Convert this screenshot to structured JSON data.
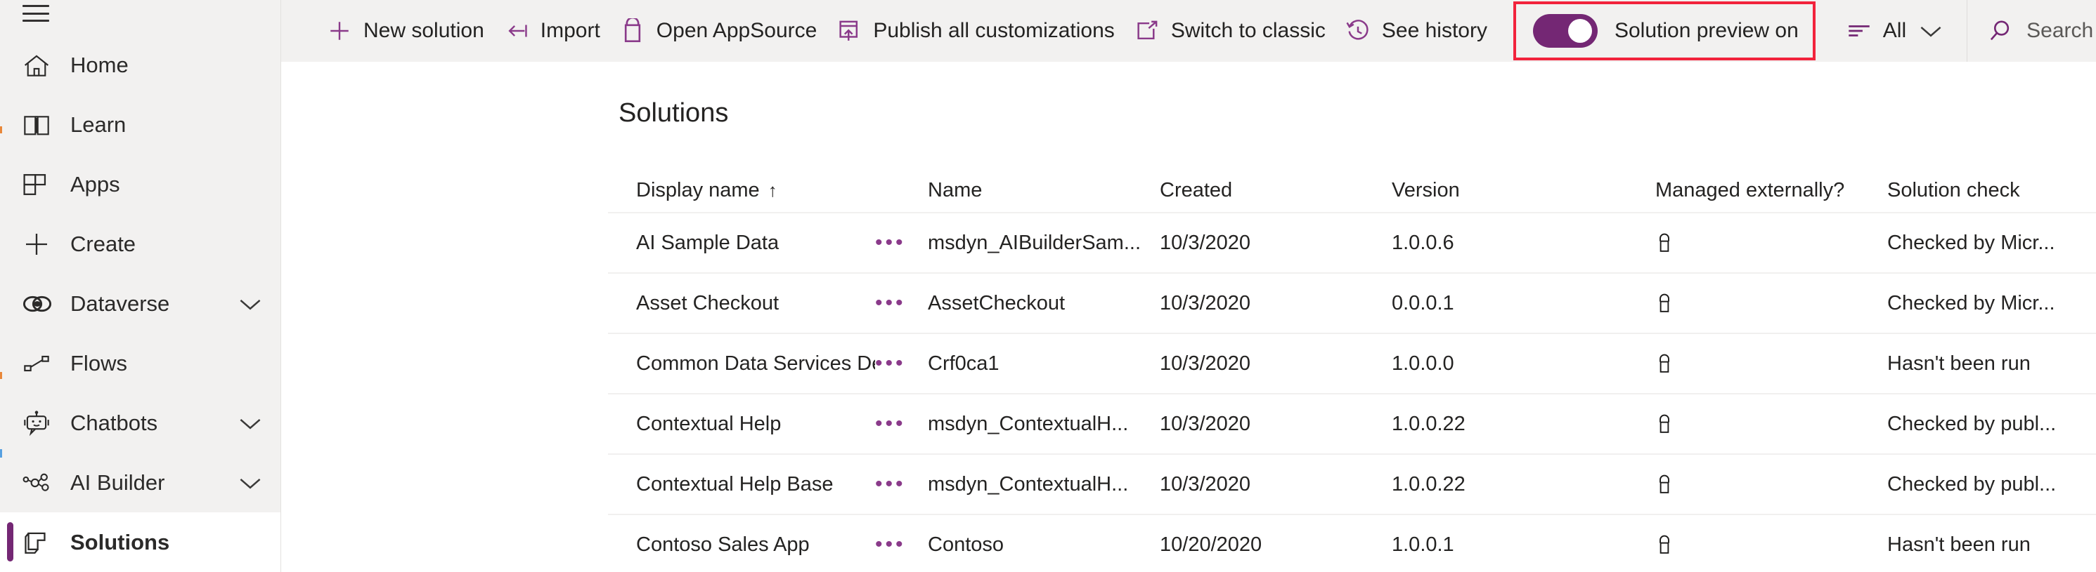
{
  "sidebar": {
    "hamburger_name": "hamburger-menu-icon",
    "items": [
      {
        "label": "Home",
        "icon": "home-icon",
        "chevron": false,
        "active": false
      },
      {
        "label": "Learn",
        "icon": "book-icon",
        "chevron": false,
        "active": false
      },
      {
        "label": "Apps",
        "icon": "apps-grid-icon",
        "chevron": false,
        "active": false
      },
      {
        "label": "Create",
        "icon": "plus-icon",
        "chevron": false,
        "active": false
      },
      {
        "label": "Dataverse",
        "icon": "dataverse-icon",
        "chevron": true,
        "active": false
      },
      {
        "label": "Flows",
        "icon": "flows-icon",
        "chevron": false,
        "active": false
      },
      {
        "label": "Chatbots",
        "icon": "chatbot-icon",
        "chevron": true,
        "active": false
      },
      {
        "label": "AI Builder",
        "icon": "ai-builder-icon",
        "chevron": true,
        "active": false
      },
      {
        "label": "Solutions",
        "icon": "solutions-icon",
        "chevron": false,
        "active": true
      }
    ]
  },
  "commandbar": {
    "commands": [
      {
        "label": "New solution",
        "icon": "plus-icon"
      },
      {
        "label": "Import",
        "icon": "import-arrow-icon"
      },
      {
        "label": "Open AppSource",
        "icon": "shopping-bag-icon"
      },
      {
        "label": "Publish all customizations",
        "icon": "publish-upload-icon"
      },
      {
        "label": "Switch to classic",
        "icon": "open-in-new-window-icon"
      },
      {
        "label": "See history",
        "icon": "history-clock-icon"
      }
    ],
    "toggle": {
      "label": "Solution preview on",
      "state": "on",
      "highlight_color": "#f2233c",
      "accent_color": "#742774"
    },
    "filter": {
      "label": "All",
      "icon": "filter-lines-icon",
      "chevron": "chevron-down-icon"
    },
    "search": {
      "label": "Search",
      "placeholder": "Search",
      "icon": "search-icon"
    }
  },
  "page": {
    "title": "Solutions"
  },
  "table": {
    "columns": [
      {
        "key": "display",
        "label": "Display name",
        "sort": "↑"
      },
      {
        "key": "name",
        "label": "Name",
        "sort": ""
      },
      {
        "key": "created",
        "label": "Created",
        "sort": ""
      },
      {
        "key": "version",
        "label": "Version",
        "sort": ""
      },
      {
        "key": "managed",
        "label": "Managed externally?",
        "sort": ""
      },
      {
        "key": "check",
        "label": "Solution check",
        "sort": ""
      }
    ],
    "row_menu_glyph": "•••",
    "managed_icon": "lock-icon",
    "rows": [
      {
        "display": "AI Sample Data",
        "name": "msdyn_AIBuilderSam...",
        "created": "10/3/2020",
        "version": "1.0.0.6",
        "managed": "lock-icon",
        "check": "Checked by Micr..."
      },
      {
        "display": "Asset Checkout",
        "name": "AssetCheckout",
        "created": "10/3/2020",
        "version": "0.0.0.1",
        "managed": "lock-icon",
        "check": "Checked by Micr..."
      },
      {
        "display": "Common Data Services Default Solution",
        "name": "Crf0ca1",
        "created": "10/3/2020",
        "version": "1.0.0.0",
        "managed": "lock-icon",
        "check": "Hasn't been run"
      },
      {
        "display": "Contextual Help",
        "name": "msdyn_ContextualH...",
        "created": "10/3/2020",
        "version": "1.0.0.22",
        "managed": "lock-icon",
        "check": "Checked by publ..."
      },
      {
        "display": "Contextual Help Base",
        "name": "msdyn_ContextualH...",
        "created": "10/3/2020",
        "version": "1.0.0.22",
        "managed": "lock-icon",
        "check": "Checked by publ..."
      },
      {
        "display": "Contoso Sales App",
        "name": "Contoso",
        "created": "10/20/2020",
        "version": "1.0.0.1",
        "managed": "lock-icon",
        "check": "Hasn't been run"
      }
    ]
  },
  "colors": {
    "sidebar_bg": "#f2f1f0",
    "command_bg": "#f2f1f0",
    "purple": "#742774",
    "icon_purple": "#8a3a8a",
    "text": "#242322",
    "row_border": "#f1f0ef"
  }
}
